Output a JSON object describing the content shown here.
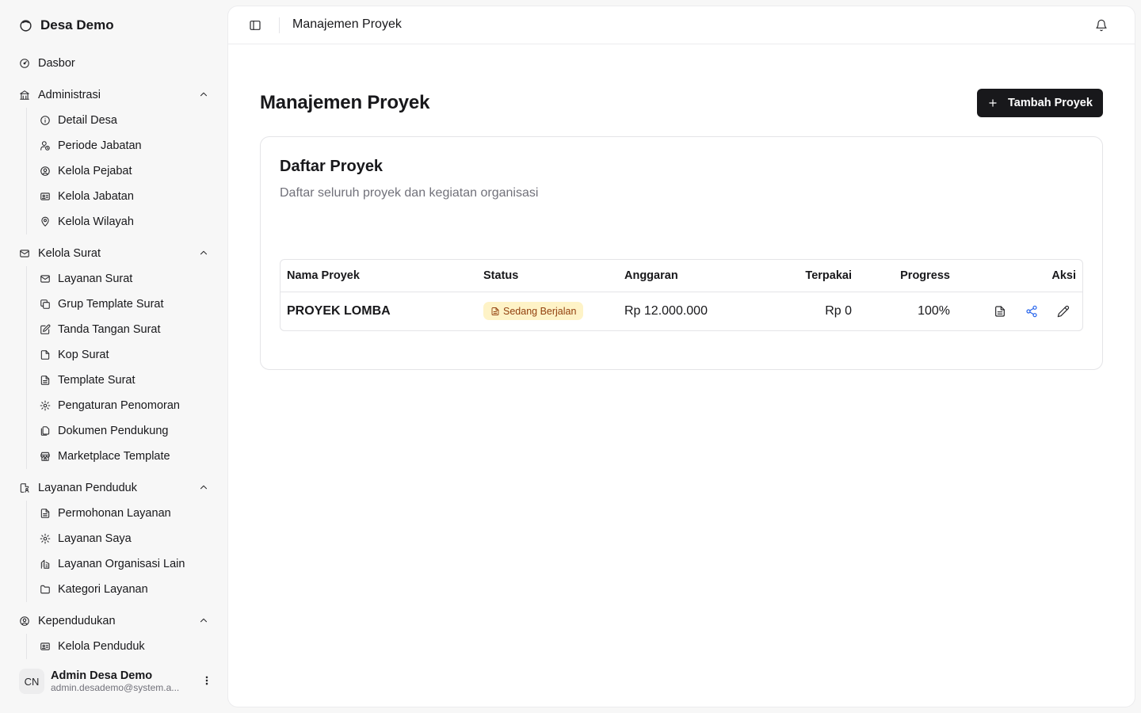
{
  "sidebar": {
    "brand": "Desa Demo",
    "dashboard": "Dasbor",
    "groups": [
      {
        "label": "Administrasi",
        "items": [
          "Detail Desa",
          "Periode Jabatan",
          "Kelola Pejabat",
          "Kelola Jabatan",
          "Kelola Wilayah"
        ]
      },
      {
        "label": "Kelola Surat",
        "items": [
          "Layanan Surat",
          "Grup Template Surat",
          "Tanda Tangan Surat",
          "Kop Surat",
          "Template Surat",
          "Pengaturan Penomoran",
          "Dokumen Pendukung",
          "Marketplace Template"
        ]
      },
      {
        "label": "Layanan Penduduk",
        "items": [
          "Permohonan Layanan",
          "Layanan Saya",
          "Layanan Organisasi Lain",
          "Kategori Layanan"
        ]
      },
      {
        "label": "Kependudukan",
        "items": [
          "Kelola Penduduk"
        ]
      }
    ],
    "user": {
      "initials": "CN",
      "name": "Admin Desa Demo",
      "email": "admin.desademo@system.a..."
    }
  },
  "topbar": {
    "title": "Manajemen Proyek"
  },
  "main": {
    "title": "Manajemen Proyek",
    "add_button": "Tambah Proyek",
    "card": {
      "title": "Daftar Proyek",
      "description": "Daftar seluruh proyek dan kegiatan organisasi",
      "columns": {
        "name": "Nama Proyek",
        "status": "Status",
        "budget": "Anggaran",
        "used": "Terpakai",
        "progress": "Progress",
        "actions": "Aksi"
      },
      "rows": [
        {
          "name": "PROYEK LOMBA",
          "status": "Sedang Berjalan",
          "budget": "Rp 12.000.000",
          "used": "Rp 0",
          "progress": "100%"
        }
      ]
    }
  },
  "colors": {
    "primary": "#18181b",
    "badge_bg": "#fef3c7",
    "badge_text": "#92400e",
    "share": "#2563eb",
    "muted": "#71717a"
  }
}
